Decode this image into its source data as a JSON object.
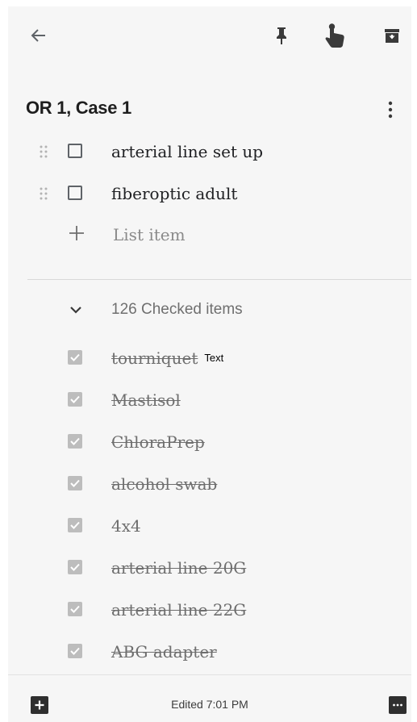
{
  "toolbar": {
    "back_icon": "arrow-left-icon",
    "pin_icon": "pin-icon",
    "reminder_icon": "hand-pointer-icon",
    "archive_icon": "archive-icon"
  },
  "note": {
    "title": "OR 1, Case 1",
    "more_icon": "more-vertical-icon",
    "unchecked_items": [
      {
        "label": "arterial line set up",
        "checked": false
      },
      {
        "label": "fiberoptic adult",
        "checked": false
      }
    ],
    "add_item_placeholder": "List item",
    "checked_header": "126 Checked items",
    "checked_items": [
      {
        "label": "tourniquet",
        "tag": "Text",
        "checked": true
      },
      {
        "label": "Mastisol",
        "checked": true
      },
      {
        "label": "ChloraPrep",
        "checked": true
      },
      {
        "label": "alcohol swab",
        "checked": true
      },
      {
        "label": "4x4",
        "checked": true
      },
      {
        "label": "arterial line 20G",
        "checked": true
      },
      {
        "label": "arterial line 22G",
        "checked": true
      },
      {
        "label": "ABG adapter",
        "checked": true
      }
    ]
  },
  "bottom_bar": {
    "add_icon": "plus-box-icon",
    "edited_label": "Edited 7:01 PM",
    "menu_icon": "more-horizontal-icon"
  },
  "colors": {
    "background": "#f6f6f6",
    "checked_box": "#bdbdbd",
    "strike_text": "#6e6e6e"
  }
}
